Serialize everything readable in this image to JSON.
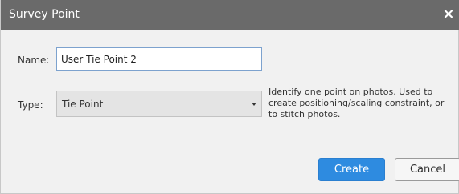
{
  "dialog": {
    "title": "Survey Point",
    "close_glyph": "×"
  },
  "form": {
    "name_label": "Name:",
    "name_value": "User Tie Point 2",
    "type_label": "Type:",
    "type_value": "Tie Point",
    "type_help": "Identify one point on photos. Used to create positioning/scaling constraint, or to stitch photos."
  },
  "buttons": {
    "create": "Create",
    "cancel": "Cancel"
  },
  "colors": {
    "titlebar": "#6a6a6a",
    "accent": "#2e8be0",
    "background": "#f1f1f1"
  },
  "icons": {
    "close": "close-icon",
    "dropdown": "chevron-down-icon"
  }
}
